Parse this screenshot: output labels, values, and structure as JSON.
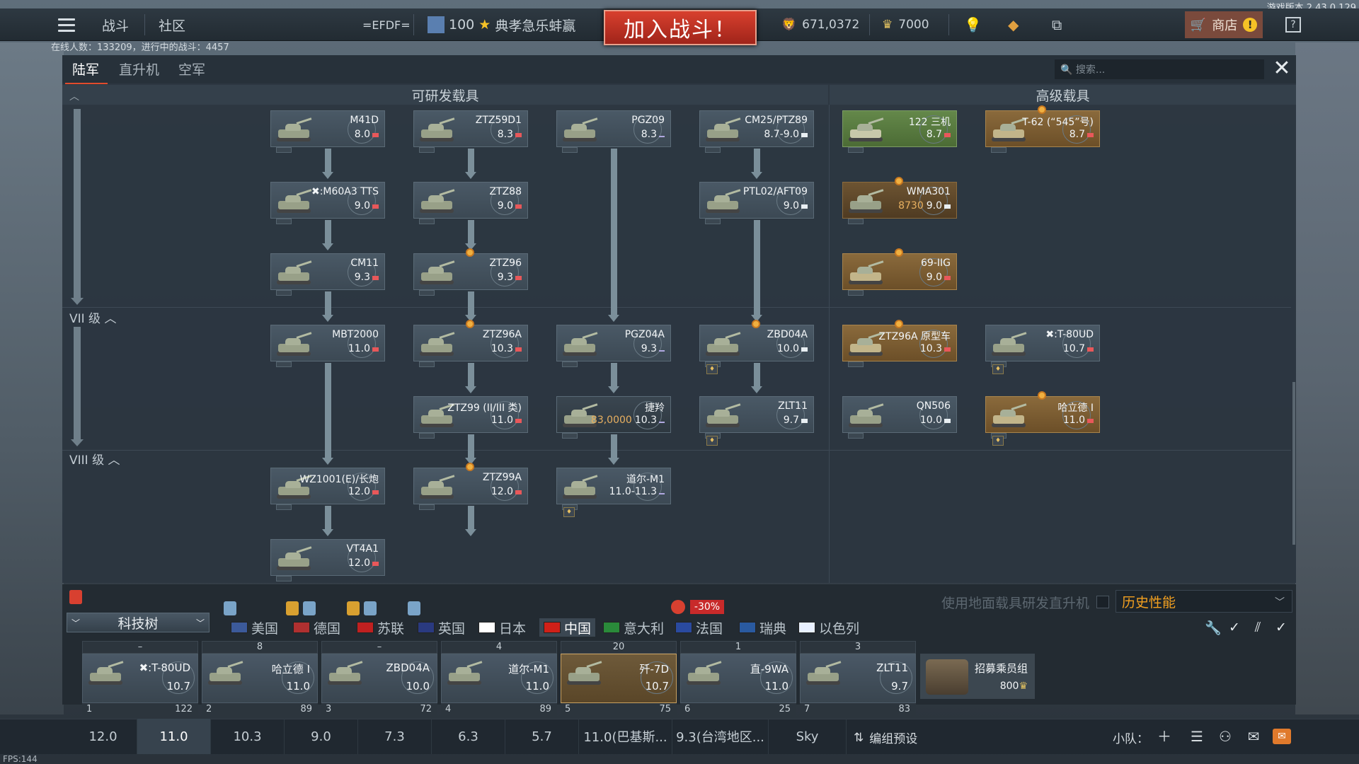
{
  "version": "游戏版本 2.43.0.129",
  "topbar": {
    "battle": "战斗",
    "community": "社区",
    "squad": "=EFDF=",
    "player_level": "100",
    "player_name": "典孝急乐蚌赢",
    "join": "加入战斗！",
    "silver": "671,0372",
    "gold": "7000",
    "shop": "商店",
    "help": "?"
  },
  "online": "在线人数：133209，进行中的战斗：4457",
  "tabs": [
    "陆军",
    "直升机",
    "空军"
  ],
  "search": {
    "placeholder": "搜索..."
  },
  "columns": {
    "research": "可研发载具",
    "premium": "高级载具"
  },
  "ranks": {
    "vii": "VII 级",
    "viii": "VIII 级"
  },
  "vehicles": [
    {
      "name": "M41D",
      "br": "8.0"
    },
    {
      "name": "ZTZ59D1",
      "br": "8.3"
    },
    {
      "name": "PGZ09",
      "br": "8.3"
    },
    {
      "name": "CM25/PTZ89",
      "br": "8.7-9.0"
    },
    {
      "name": "122 三机",
      "br": "8.7"
    },
    {
      "name": "T-62 (“545”号)",
      "br": "8.7"
    },
    {
      "name": "✖:M60A3 TTS",
      "br": "9.0"
    },
    {
      "name": "ZTZ88",
      "br": "9.0"
    },
    {
      "name": "PTL02/AFT09",
      "br": "9.0"
    },
    {
      "name": "WMA301",
      "br": "9.0",
      "cost": "8730"
    },
    {
      "name": "CM11",
      "br": "9.3"
    },
    {
      "name": "ZTZ96",
      "br": "9.3"
    },
    {
      "name": "69-IIG",
      "br": "9.0"
    },
    {
      "name": "MBT2000",
      "br": "11.0"
    },
    {
      "name": "ZTZ96A",
      "br": "10.3"
    },
    {
      "name": "PGZ04A",
      "br": "9.3"
    },
    {
      "name": "ZBD04A",
      "br": "10.0"
    },
    {
      "name": "ZTZ96A 原型车",
      "br": "10.3"
    },
    {
      "name": "✖:T-80UD",
      "br": "10.7"
    },
    {
      "name": "ZTZ99 (II/III 类)",
      "br": "11.0"
    },
    {
      "name": "捷羚",
      "br": "10.3",
      "cost": "83,0000"
    },
    {
      "name": "ZLT11",
      "br": "9.7"
    },
    {
      "name": "QN506",
      "br": "10.0"
    },
    {
      "name": "哈立德 I",
      "br": "11.0"
    },
    {
      "name": "WZ1001(E)/长炮",
      "br": "12.0"
    },
    {
      "name": "ZTZ99A",
      "br": "12.0"
    },
    {
      "name": "道尔-M1",
      "br": "11.0-11.3"
    },
    {
      "name": "VT4A1",
      "br": "12.0"
    }
  ],
  "shelf": {
    "label": "科技树",
    "option": "使用地面载具研发直升机",
    "dropdown": "历史性能",
    "sale": "-30%"
  },
  "nations": [
    "美国",
    "德国",
    "苏联",
    "英国",
    "日本",
    "中国",
    "意大利",
    "法国",
    "瑞典",
    "以色列"
  ],
  "slots": [
    {
      "top": "–",
      "name": "✖:T-80UD",
      "br": "10.7",
      "num": "1",
      "pts": "122"
    },
    {
      "top": "8",
      "name": "哈立德 I",
      "br": "11.0",
      "num": "2",
      "pts": "89"
    },
    {
      "top": "–",
      "name": "ZBD04A",
      "br": "10.0",
      "num": "3",
      "pts": "72"
    },
    {
      "top": "4",
      "name": "道尔-M1",
      "br": "11.0",
      "num": "4",
      "pts": "89"
    },
    {
      "top": "20",
      "name": "歼-7D",
      "br": "10.7",
      "num": "5",
      "pts": "75"
    },
    {
      "top": "1",
      "name": "直-9WA",
      "br": "11.0",
      "num": "6",
      "pts": "25"
    },
    {
      "top": "3",
      "name": "ZLT11",
      "br": "9.7",
      "num": "7",
      "pts": "83"
    }
  ],
  "crew": {
    "label": "招募乘员组",
    "cost": "800"
  },
  "br_tabs": [
    "12.0",
    "11.0",
    "10.3",
    "9.0",
    "7.3",
    "6.3",
    "5.7",
    "11.0(巴基斯...",
    "9.3(台湾地区...",
    "Sky"
  ],
  "presets": "编组预设",
  "squad_label": "小队：",
  "fps": "FPS:144",
  "colors": {
    "accent": "#e24c2c",
    "join": "#c4352a",
    "premium": "#8a6a3c",
    "event": "#64884a"
  }
}
